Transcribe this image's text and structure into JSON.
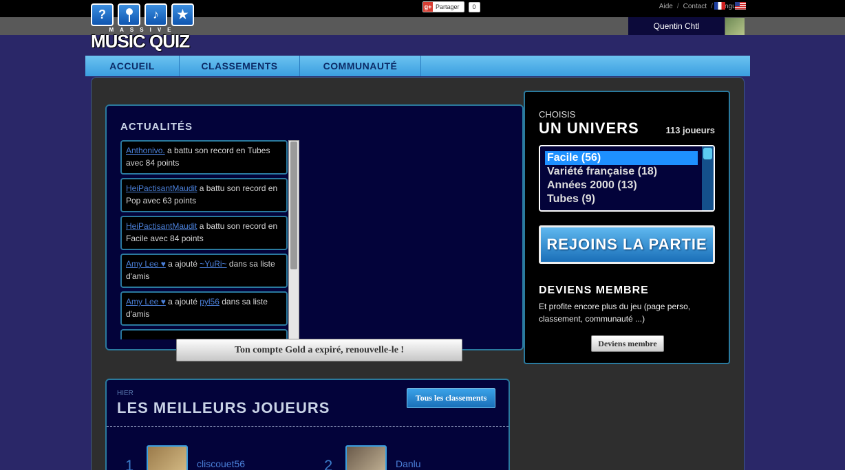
{
  "topbar": {
    "share_label": "Partager",
    "share_count": "0",
    "links": [
      "Aide",
      "Contact",
      "Langue"
    ],
    "user_name": "Quentin Chtl"
  },
  "logo": {
    "icons": [
      "?",
      "🎤",
      "♪",
      "★"
    ],
    "massive": "MASSIVE",
    "title": "MUSIC QUIZ"
  },
  "nav": {
    "items": [
      "ACCUEIL",
      "CLASSEMENTS",
      "COMMUNAUTÉ"
    ]
  },
  "news": {
    "title": "ACTUALITÉS",
    "items": [
      {
        "user": "Anthonivo.",
        "text": " a battu son record en Tubes avec 84 points"
      },
      {
        "user": "HeiPactisantMaudit",
        "text": " a battu son record en Pop avec 63 points"
      },
      {
        "user": "HeiPactisantMaudit",
        "text": " a battu son record en Facile avec 84 points"
      },
      {
        "user": "Amy Lee ♥",
        "text": " a ajouté ",
        "target": "~YuRi~",
        "tail": " dans sa liste d'amis"
      },
      {
        "user": "Amy Lee ♥",
        "text": " a ajouté ",
        "target": "pyl56",
        "tail": " dans sa liste d'amis"
      }
    ]
  },
  "gold_message": "Ton compte Gold a expiré, renouvelle-le !",
  "side": {
    "choisis": "CHOISIS",
    "univers": "UN UNIVERS",
    "joueurs": "113 joueurs",
    "universes": [
      "Facile (56)",
      "Variété française (18)",
      "Années 2000 (13)",
      "Tubes (9)"
    ],
    "selected_index": 0,
    "join_label": "REJOINS LA PARTIE",
    "member_title": "DEVIENS MEMBRE",
    "member_text": "Et profite encore plus du jeu (page perso, classement, communauté ...)",
    "member_button": "Deviens membre"
  },
  "best": {
    "hier": "HIER",
    "title": "LES MEILLEURS JOUEURS",
    "all_rankings": "Tous les classements",
    "players": [
      {
        "rank": "1",
        "name": "cliscouet56"
      },
      {
        "rank": "2",
        "name": "Danlu"
      }
    ]
  }
}
